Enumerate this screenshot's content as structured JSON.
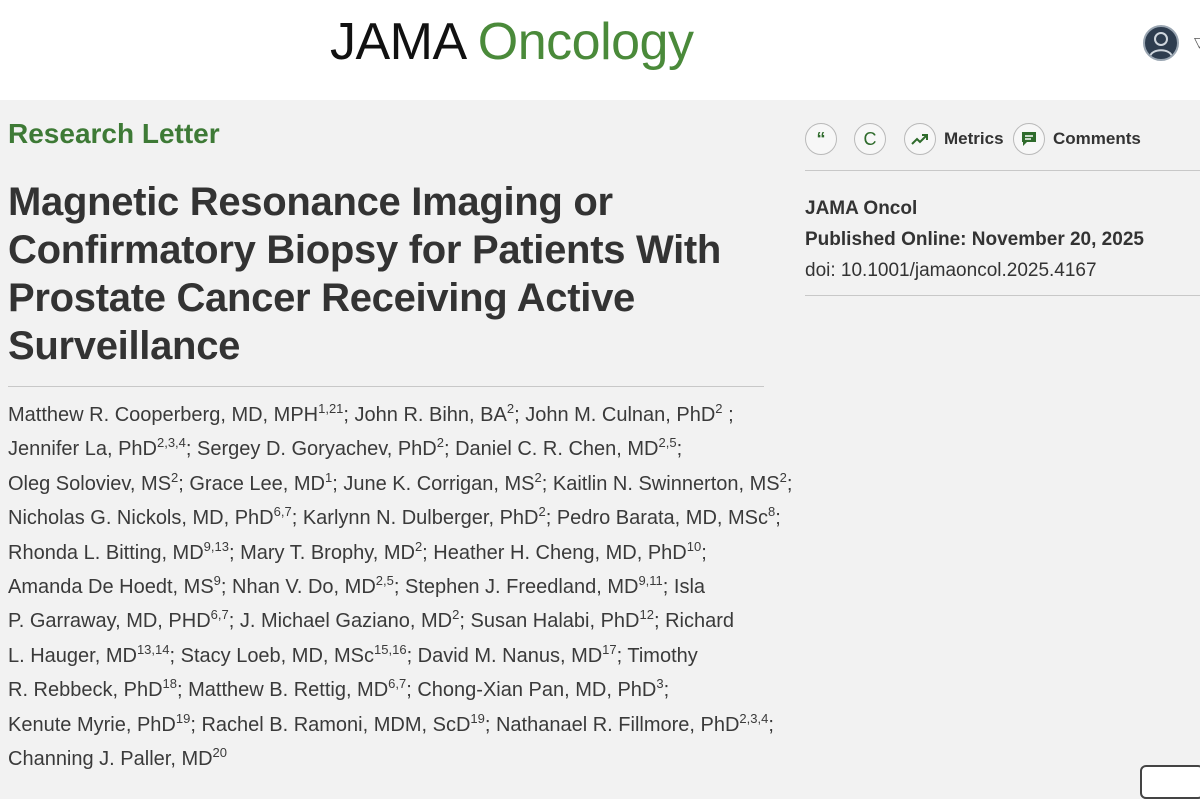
{
  "header": {
    "logo_primary": "JAMA",
    "logo_secondary": "Oncology",
    "colors": {
      "brand_green": "#4a8a3a",
      "text_dark": "#111111"
    }
  },
  "article": {
    "kicker": "Research Letter",
    "title": "Magnetic Resonance Imaging or Confirmatory Biopsy for Patients With Prostate Cancer Receiving Active Surveillance",
    "authors": [
      [
        [
          "Matthew R. Cooperberg, MD, MPH",
          "1,21"
        ],
        [
          "; John R. Bihn, BA",
          "2"
        ],
        [
          "; John M. Culnan, PhD",
          "2"
        ],
        [
          " ;",
          ""
        ]
      ],
      [
        [
          "Jennifer La, PhD",
          "2,3,4"
        ],
        [
          "; Sergey D. Goryachev, PhD",
          "2"
        ],
        [
          "; Daniel C. R. Chen, MD",
          "2,5"
        ],
        [
          ";",
          ""
        ]
      ],
      [
        [
          "Oleg Soloviev, MS",
          "2"
        ],
        [
          "; Grace Lee, MD",
          "1"
        ],
        [
          "; June K. Corrigan, MS",
          "2"
        ],
        [
          "; Kaitlin N. Swinnerton, MS",
          "2"
        ],
        [
          ";",
          ""
        ]
      ],
      [
        [
          "Nicholas G. Nickols, MD, PhD",
          "6,7"
        ],
        [
          "; Karlynn N. Dulberger, PhD",
          "2"
        ],
        [
          "; Pedro Barata, MD, MSc",
          "8"
        ],
        [
          ";",
          ""
        ]
      ],
      [
        [
          "Rhonda L. Bitting, MD",
          "9,13"
        ],
        [
          "; Mary T. Brophy, MD",
          "2"
        ],
        [
          "; Heather H. Cheng, MD, PhD",
          "10"
        ],
        [
          ";",
          ""
        ]
      ],
      [
        [
          "Amanda De Hoedt, MS",
          "9"
        ],
        [
          "; Nhan V. Do, MD",
          "2,5"
        ],
        [
          "; Stephen J. Freedland, MD",
          "9,11"
        ],
        [
          "; Isla",
          ""
        ]
      ],
      [
        [
          "P. Garraway, MD, PHD",
          "6,7"
        ],
        [
          "; J. Michael Gaziano, MD",
          "2"
        ],
        [
          "; Susan Halabi, PhD",
          "12"
        ],
        [
          "; Richard",
          ""
        ]
      ],
      [
        [
          "L. Hauger, MD",
          "13,14"
        ],
        [
          "; Stacy Loeb, MD, MSc",
          "15,16"
        ],
        [
          "; David M. Nanus, MD",
          "17"
        ],
        [
          "; Timothy",
          ""
        ]
      ],
      [
        [
          "R. Rebbeck, PhD",
          "18"
        ],
        [
          "; Matthew B. Rettig, MD",
          "6,7"
        ],
        [
          "; Chong-Xian Pan, MD, PhD",
          "3"
        ],
        [
          ";",
          ""
        ]
      ],
      [
        [
          "Kenute Myrie, PhD",
          "19"
        ],
        [
          "; Rachel B. Ramoni, MDM, ScD",
          "19"
        ],
        [
          "; Nathanael R. Fillmore, PhD",
          "2,3,4"
        ],
        [
          ";",
          ""
        ]
      ],
      [
        [
          "Channing J. Paller, MD",
          "20"
        ]
      ]
    ]
  },
  "toolbar": {
    "cite_glyph": "“",
    "c_glyph": "C",
    "metrics_label": "Metrics",
    "comments_label": "Comments",
    "icons": [
      "quote-icon",
      "c-icon",
      "trend-up-icon",
      "comment-icon"
    ]
  },
  "meta": {
    "journal": "JAMA Oncol",
    "published": "Published Online: November 20, 2025",
    "doi": "doi: 10.1001/jamaoncol.2025.4167"
  }
}
